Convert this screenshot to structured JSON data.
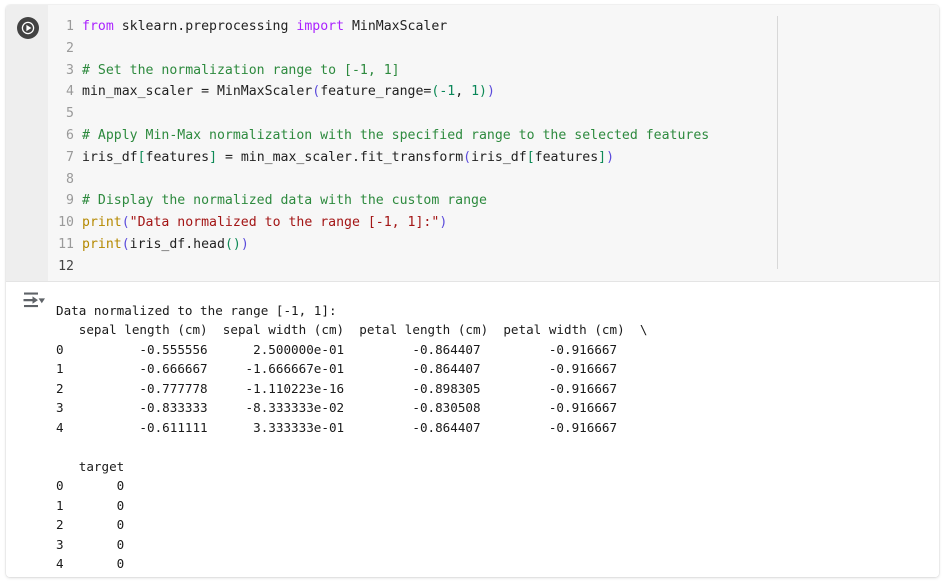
{
  "cell": {
    "run_button": {
      "name": "run-cell",
      "icon": "play-icon",
      "color": "#424242"
    },
    "output_toggle": {
      "name": "output-options",
      "icon": "output-arrow-icon"
    }
  },
  "code": {
    "language": "python",
    "line_numbers": [
      "1",
      "2",
      "3",
      "4",
      "5",
      "6",
      "7",
      "8",
      "9",
      "10",
      "11",
      "12"
    ],
    "lines": [
      {
        "n": "1",
        "tokens": [
          {
            "text": "from",
            "type": "keyword"
          },
          {
            "text": " sklearn.preprocessing ",
            "type": "plain"
          },
          {
            "text": "import",
            "type": "keyword"
          },
          {
            "text": " MinMaxScaler",
            "type": "plain"
          }
        ]
      },
      {
        "n": "2",
        "tokens": []
      },
      {
        "n": "3",
        "tokens": [
          {
            "text": "# Set the normalization range to [-1, 1]",
            "type": "comment"
          }
        ]
      },
      {
        "n": "4",
        "tokens": [
          {
            "text": "min_max_scaler = MinMaxScaler",
            "type": "plain"
          },
          {
            "text": "(",
            "type": "bracket1"
          },
          {
            "text": "feature_range=",
            "type": "plain"
          },
          {
            "text": "(",
            "type": "bracket2"
          },
          {
            "text": "-1",
            "type": "number"
          },
          {
            "text": ", ",
            "type": "plain"
          },
          {
            "text": "1",
            "type": "number"
          },
          {
            "text": ")",
            "type": "bracket2"
          },
          {
            "text": ")",
            "type": "bracket1"
          }
        ]
      },
      {
        "n": "5",
        "tokens": []
      },
      {
        "n": "6",
        "tokens": [
          {
            "text": "# Apply Min-Max normalization with the specified range to the selected features",
            "type": "comment"
          }
        ]
      },
      {
        "n": "7",
        "tokens": [
          {
            "text": "iris_df",
            "type": "plain"
          },
          {
            "text": "[",
            "type": "bracket2"
          },
          {
            "text": "features",
            "type": "plain"
          },
          {
            "text": "]",
            "type": "bracket2"
          },
          {
            "text": " = min_max_scaler.fit_transform",
            "type": "plain"
          },
          {
            "text": "(",
            "type": "bracket1"
          },
          {
            "text": "iris_df",
            "type": "plain"
          },
          {
            "text": "[",
            "type": "bracket2"
          },
          {
            "text": "features",
            "type": "plain"
          },
          {
            "text": "]",
            "type": "bracket2"
          },
          {
            "text": ")",
            "type": "bracket1"
          }
        ]
      },
      {
        "n": "8",
        "tokens": []
      },
      {
        "n": "9",
        "tokens": [
          {
            "text": "# Display the normalized data with the custom range",
            "type": "comment"
          }
        ]
      },
      {
        "n": "10",
        "tokens": [
          {
            "text": "print",
            "type": "function"
          },
          {
            "text": "(",
            "type": "bracket1"
          },
          {
            "text": "\"Data normalized to the range [-1, 1]:\"",
            "type": "string"
          },
          {
            "text": ")",
            "type": "bracket1"
          }
        ]
      },
      {
        "n": "11",
        "tokens": [
          {
            "text": "print",
            "type": "function"
          },
          {
            "text": "(",
            "type": "bracket1"
          },
          {
            "text": "iris_df.head",
            "type": "plain"
          },
          {
            "text": "(",
            "type": "bracket2"
          },
          {
            "text": ")",
            "type": "bracket2"
          },
          {
            "text": ")",
            "type": "bracket1"
          }
        ]
      },
      {
        "n": "12",
        "tokens": []
      }
    ]
  },
  "output": {
    "header_line": "Data normalized to the range [-1, 1]:",
    "table1": {
      "columns": [
        "sepal length (cm)",
        "sepal width (cm)",
        "petal length (cm)",
        "petal width (cm)"
      ],
      "continuation_marker": "\\",
      "index": [
        "0",
        "1",
        "2",
        "3",
        "4"
      ],
      "rows": [
        [
          "-0.555556",
          "2.500000e-01",
          "-0.864407",
          "-0.916667"
        ],
        [
          "-0.666667",
          "-1.666667e-01",
          "-0.864407",
          "-0.916667"
        ],
        [
          "-0.777778",
          "-1.110223e-16",
          "-0.898305",
          "-0.916667"
        ],
        [
          "-0.833333",
          "-8.333333e-02",
          "-0.830508",
          "-0.916667"
        ],
        [
          "-0.611111",
          "3.333333e-01",
          "-0.864407",
          "-0.916667"
        ]
      ]
    },
    "table2": {
      "columns": [
        "target"
      ],
      "index": [
        "0",
        "1",
        "2",
        "3",
        "4"
      ],
      "rows": [
        [
          "0"
        ],
        [
          "0"
        ],
        [
          "0"
        ],
        [
          "0"
        ],
        [
          "0"
        ]
      ]
    },
    "raw_text": "Data normalized to the range [-1, 1]:\n   sepal length (cm)  sepal width (cm)  petal length (cm)  petal width (cm)  \\\n0          -0.555556      2.500000e-01         -0.864407         -0.916667\n1          -0.666667     -1.666667e-01         -0.864407         -0.916667\n2          -0.777778     -1.110223e-16         -0.898305         -0.916667\n3          -0.833333     -8.333333e-02         -0.830508         -0.916667\n4          -0.611111      3.333333e-01         -0.864407         -0.916667\n\n   target\n0       0\n1       0\n2       0\n3       0\n4       0"
  },
  "colors": {
    "keyword": "#aa22ff",
    "comment": "#2d8a3e",
    "string": "#a31515",
    "number": "#098658",
    "function": "#b58900",
    "bracket1": "#5b4bdb",
    "bracket2": "#0e8a56",
    "plain": "#222222",
    "gutter_bg": "#eeeeee",
    "code_bg": "#f7f7f7",
    "output_bg": "#ffffff"
  }
}
